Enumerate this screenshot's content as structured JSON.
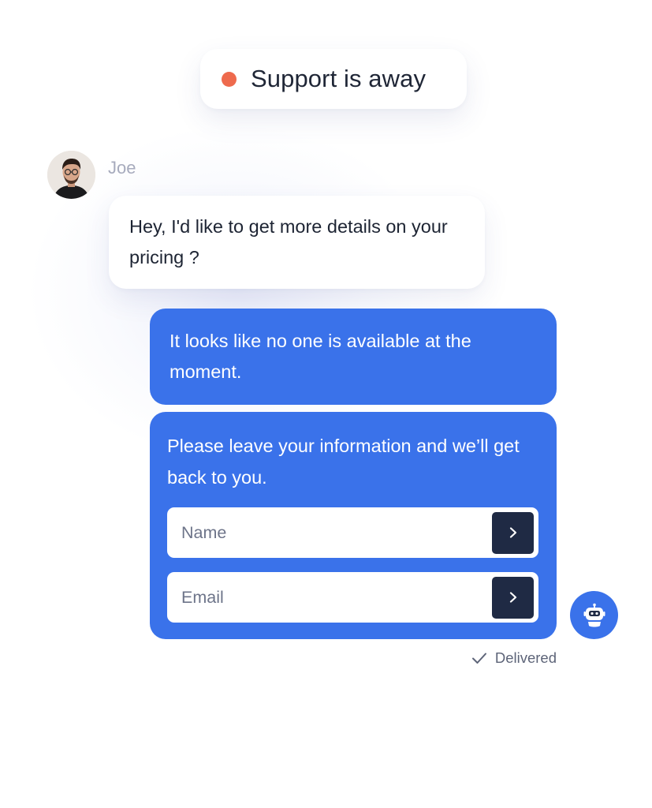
{
  "status": {
    "label": "Support is away",
    "dot_color": "#ee6a4d"
  },
  "visitor": {
    "name": "Joe",
    "avatar_icon": "user-photo-avatar",
    "message": "Hey, I'd like to get more details on your pricing ?"
  },
  "agent": {
    "message": "It looks like no one is available at the moment.",
    "form_prompt": "Please leave your information and we’ll get back to you.",
    "name_field": {
      "placeholder": "Name",
      "value": "",
      "submit_icon": "chevron-right-icon"
    },
    "email_field": {
      "placeholder": "Email",
      "value": "",
      "submit_icon": "chevron-right-icon"
    },
    "bot_icon": "robot-icon"
  },
  "delivery": {
    "status": "Delivered",
    "icon": "checkmark-icon"
  },
  "colors": {
    "accent": "#3a72ea",
    "button_dark": "#1f2a44",
    "away": "#ee6a4d",
    "muted_text": "#a7abbd"
  }
}
